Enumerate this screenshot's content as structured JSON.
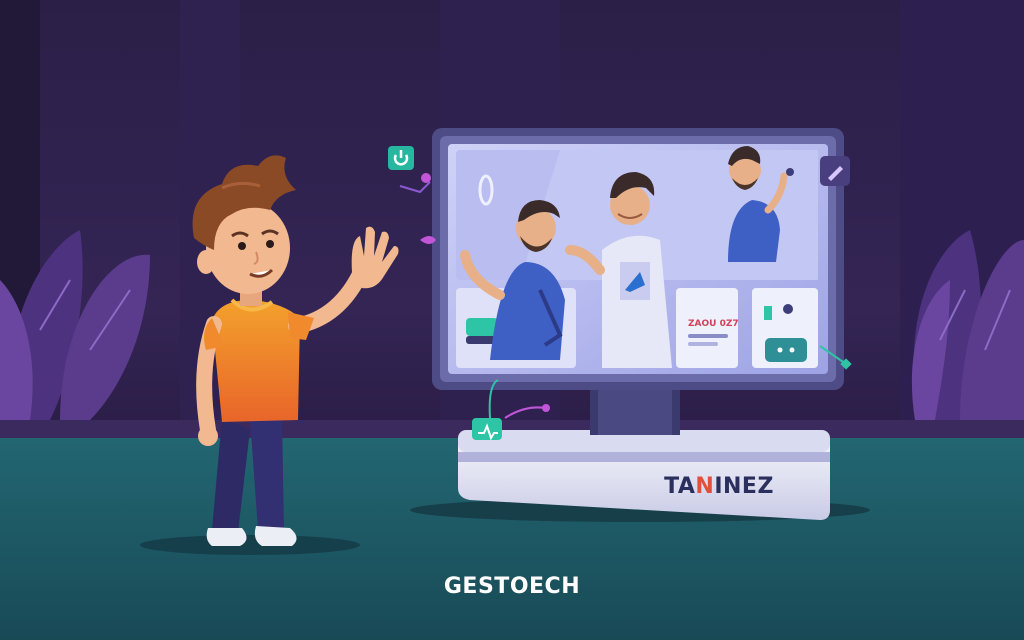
{
  "brand": {
    "caption": "GESTOECH",
    "device_label_part1": "TA",
    "device_label_accent": "N",
    "device_label_part2": "INEZ",
    "screen_note": "ZAOU 0Z7"
  },
  "colors": {
    "background": "#2a1d45",
    "floor": "#1f5a68",
    "screen_frame": "#5b5a92",
    "screen_glow": "#b7b9f0",
    "accent_teal": "#2ec4a6",
    "accent_orange": "#f08a2c",
    "plant": "#5b3b8c"
  },
  "icons": [
    "power-icon",
    "chat-bubble-icon",
    "edit-icon",
    "pulse-icon",
    "heart-icon"
  ]
}
